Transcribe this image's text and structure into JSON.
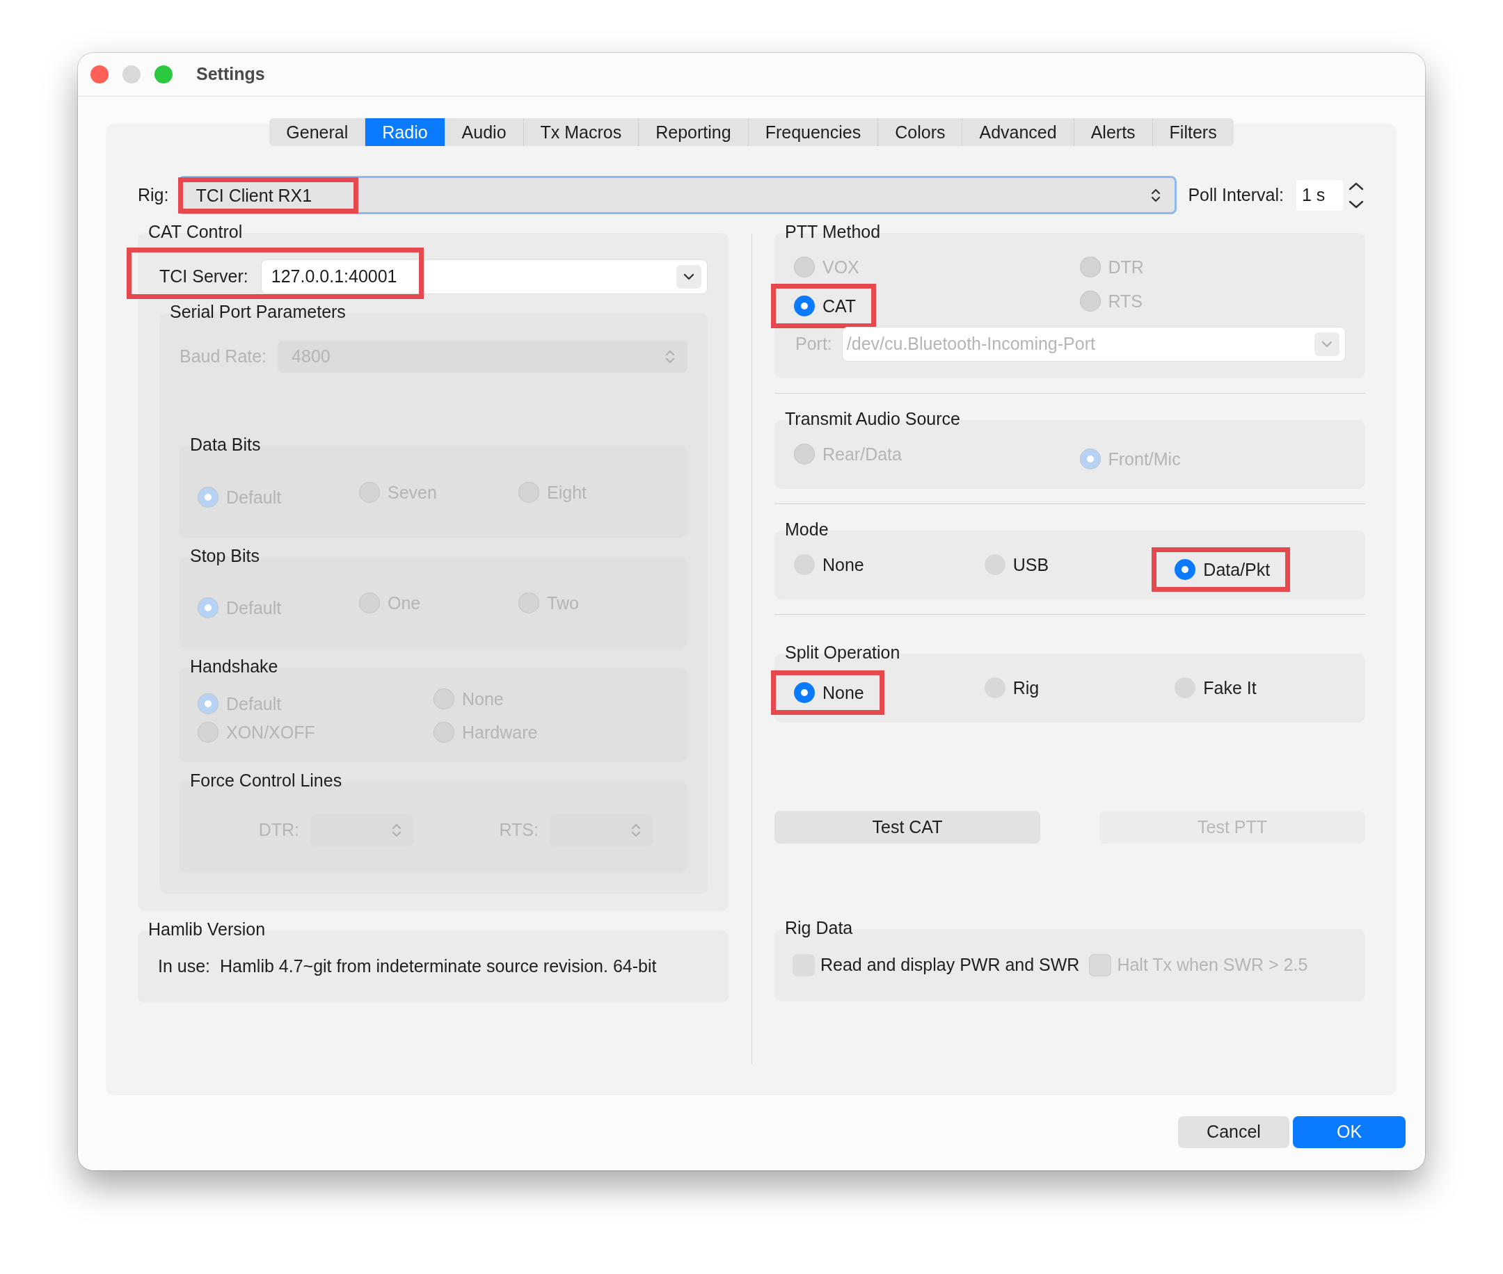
{
  "window": {
    "title": "Settings"
  },
  "tabs": [
    {
      "label": "General",
      "selected": false
    },
    {
      "label": "Radio",
      "selected": true
    },
    {
      "label": "Audio",
      "selected": false
    },
    {
      "label": "Tx Macros",
      "selected": false
    },
    {
      "label": "Reporting",
      "selected": false
    },
    {
      "label": "Frequencies",
      "selected": false
    },
    {
      "label": "Colors",
      "selected": false
    },
    {
      "label": "Advanced",
      "selected": false
    },
    {
      "label": "Alerts",
      "selected": false
    },
    {
      "label": "Filters",
      "selected": false
    }
  ],
  "rig": {
    "label": "Rig:",
    "value": "TCI Client RX1",
    "highlighted": true
  },
  "poll_interval": {
    "label": "Poll Interval:",
    "value": "1 s"
  },
  "cat_control": {
    "title": "CAT Control",
    "tci_server": {
      "label": "TCI Server:",
      "value": "127.0.0.1:40001",
      "highlighted": true
    },
    "serial_port": {
      "title": "Serial Port Parameters",
      "disabled": true,
      "baud_rate": {
        "label": "Baud Rate:",
        "value": "4800"
      },
      "groups": [
        {
          "title": "Data Bits",
          "options": [
            {
              "label": "Default",
              "selected": true
            },
            {
              "label": "Seven",
              "selected": false
            },
            {
              "label": "Eight",
              "selected": false
            }
          ]
        },
        {
          "title": "Stop Bits",
          "options": [
            {
              "label": "Default",
              "selected": true
            },
            {
              "label": "One",
              "selected": false
            },
            {
              "label": "Two",
              "selected": false
            }
          ]
        },
        {
          "title": "Handshake",
          "options": [
            {
              "label": "Default",
              "selected": true
            },
            {
              "label": "None",
              "selected": false
            },
            {
              "label": "XON/XOFF",
              "selected": false
            },
            {
              "label": "Hardware",
              "selected": false
            }
          ]
        }
      ],
      "force_control_lines": {
        "title": "Force Control Lines",
        "fields": [
          {
            "label": "DTR:"
          },
          {
            "label": "RTS:"
          }
        ]
      }
    }
  },
  "hamlib_version": {
    "title": "Hamlib Version",
    "label": "In use:",
    "value": "Hamlib 4.7~git from indeterminate source revision. 64-bit"
  },
  "right_groups": [
    {
      "title": "PTT Method",
      "options": [
        {
          "label": "VOX",
          "selected": false,
          "disabled": true,
          "highlighted": false
        },
        {
          "label": "DTR",
          "selected": false,
          "disabled": true,
          "highlighted": false
        },
        {
          "label": "CAT",
          "selected": true,
          "disabled": false,
          "highlighted": true
        },
        {
          "label": "RTS",
          "selected": false,
          "disabled": true,
          "highlighted": false
        }
      ],
      "port": {
        "label": "Port:",
        "value": "/dev/cu.Bluetooth-Incoming-Port",
        "disabled": true
      }
    },
    {
      "title": "Transmit Audio Source",
      "options": [
        {
          "label": "Rear/Data",
          "selected": false,
          "disabled": true,
          "highlighted": false
        },
        {
          "label": "Front/Mic",
          "selected": true,
          "disabled": true,
          "highlighted": false
        }
      ]
    },
    {
      "title": "Mode",
      "options": [
        {
          "label": "None",
          "selected": false,
          "disabled": false,
          "highlighted": false
        },
        {
          "label": "USB",
          "selected": false,
          "disabled": false,
          "highlighted": false
        },
        {
          "label": "Data/Pkt",
          "selected": true,
          "disabled": false,
          "highlighted": true
        }
      ]
    },
    {
      "title": "Split Operation",
      "options": [
        {
          "label": "None",
          "selected": true,
          "disabled": false,
          "highlighted": true
        },
        {
          "label": "Rig",
          "selected": false,
          "disabled": false,
          "highlighted": false
        },
        {
          "label": "Fake It",
          "selected": false,
          "disabled": false,
          "highlighted": false
        }
      ]
    }
  ],
  "test_buttons": [
    {
      "label": "Test CAT",
      "disabled": false
    },
    {
      "label": "Test PTT",
      "disabled": true
    }
  ],
  "rig_data": {
    "title": "Rig Data",
    "checkboxes": [
      {
        "label": "Read and display PWR and SWR",
        "checked": false,
        "disabled": false
      },
      {
        "label": "Halt Tx when SWR > 2.5",
        "checked": false,
        "disabled": true
      }
    ]
  },
  "buttons": [
    {
      "label": "Cancel",
      "default": false
    },
    {
      "label": "OK",
      "default": true
    }
  ]
}
